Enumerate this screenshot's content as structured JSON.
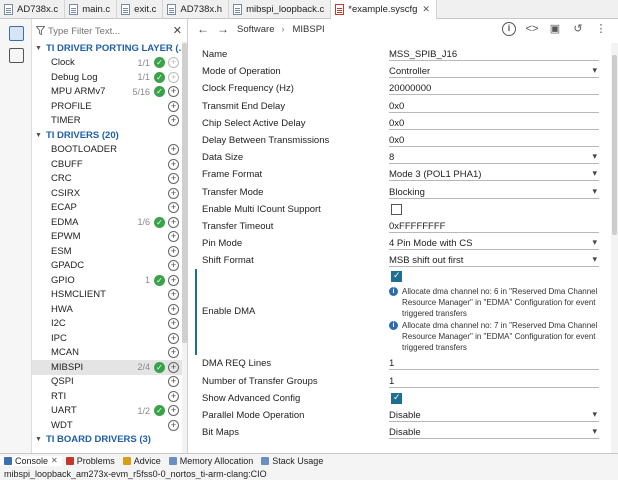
{
  "tabs": [
    {
      "label": "AD738x.c",
      "type": "c",
      "active": false,
      "dirty": false
    },
    {
      "label": "main.c",
      "type": "c",
      "active": false,
      "dirty": false
    },
    {
      "label": "exit.c",
      "type": "c",
      "active": false,
      "dirty": false
    },
    {
      "label": "AD738x.h",
      "type": "h",
      "active": false,
      "dirty": false
    },
    {
      "label": "mibspi_loopback.c",
      "type": "c",
      "active": false,
      "dirty": false
    },
    {
      "label": "*example.syscfg",
      "type": "cfg",
      "active": true,
      "dirty": true
    }
  ],
  "filter": {
    "placeholder": "Type Filter Text..."
  },
  "tree": [
    {
      "kind": "cat",
      "label": "TI DRIVER PORTING LAYER (..."
    },
    {
      "kind": "mod",
      "label": "Clock",
      "count": "1/1",
      "checked": true,
      "addable": false
    },
    {
      "kind": "mod",
      "label": "Debug Log",
      "count": "1/1",
      "checked": true,
      "addable": false
    },
    {
      "kind": "mod",
      "label": "MPU ARMv7",
      "count": "5/16",
      "checked": true,
      "addable": true
    },
    {
      "kind": "mod",
      "label": "PROFILE",
      "count": "",
      "checked": false,
      "addable": true
    },
    {
      "kind": "mod",
      "label": "TIMER",
      "count": "",
      "checked": false,
      "addable": true
    },
    {
      "kind": "cat",
      "label": "TI DRIVERS (20)"
    },
    {
      "kind": "mod",
      "label": "BOOTLOADER",
      "count": "",
      "checked": false,
      "addable": true
    },
    {
      "kind": "mod",
      "label": "CBUFF",
      "count": "",
      "checked": false,
      "addable": true
    },
    {
      "kind": "mod",
      "label": "CRC",
      "count": "",
      "checked": false,
      "addable": true
    },
    {
      "kind": "mod",
      "label": "CSIRX",
      "count": "",
      "checked": false,
      "addable": true
    },
    {
      "kind": "mod",
      "label": "ECAP",
      "count": "",
      "checked": false,
      "addable": true
    },
    {
      "kind": "mod",
      "label": "EDMA",
      "count": "1/6",
      "checked": true,
      "addable": true
    },
    {
      "kind": "mod",
      "label": "EPWM",
      "count": "",
      "checked": false,
      "addable": true
    },
    {
      "kind": "mod",
      "label": "ESM",
      "count": "",
      "checked": false,
      "addable": true
    },
    {
      "kind": "mod",
      "label": "GPADC",
      "count": "",
      "checked": false,
      "addable": true
    },
    {
      "kind": "mod",
      "label": "GPIO",
      "count": "1",
      "checked": true,
      "addable": true
    },
    {
      "kind": "mod",
      "label": "HSMCLIENT",
      "count": "",
      "checked": false,
      "addable": true
    },
    {
      "kind": "mod",
      "label": "HWA",
      "count": "",
      "checked": false,
      "addable": true
    },
    {
      "kind": "mod",
      "label": "I2C",
      "count": "",
      "checked": false,
      "addable": true
    },
    {
      "kind": "mod",
      "label": "IPC",
      "count": "",
      "checked": false,
      "addable": true
    },
    {
      "kind": "mod",
      "label": "MCAN",
      "count": "",
      "checked": false,
      "addable": true
    },
    {
      "kind": "mod",
      "label": "MIBSPI",
      "count": "2/4",
      "checked": true,
      "addable": true,
      "selected": true
    },
    {
      "kind": "mod",
      "label": "QSPI",
      "count": "",
      "checked": false,
      "addable": true
    },
    {
      "kind": "mod",
      "label": "RTI",
      "count": "",
      "checked": false,
      "addable": true
    },
    {
      "kind": "mod",
      "label": "UART",
      "count": "1/2",
      "checked": true,
      "addable": true
    },
    {
      "kind": "mod",
      "label": "WDT",
      "count": "",
      "checked": false,
      "addable": true
    },
    {
      "kind": "cat",
      "label": "TI BOARD DRIVERS (3)"
    }
  ],
  "breadcrumb": [
    "Software",
    "MIBSPI"
  ],
  "form": [
    {
      "label": "Name",
      "type": "text",
      "value": "MSS_SPIB_J16"
    },
    {
      "label": "Mode of Operation",
      "type": "select",
      "value": "Controller"
    },
    {
      "label": "Clock Frequency (Hz)",
      "type": "text",
      "value": "20000000"
    },
    {
      "label": "Transmit End Delay",
      "type": "text",
      "value": "0x0"
    },
    {
      "label": "Chip Select Active Delay",
      "type": "text",
      "value": "0x0"
    },
    {
      "label": "Delay Between Transmissions",
      "type": "text",
      "value": "0x0"
    },
    {
      "label": "Data Size",
      "type": "select",
      "value": "8"
    },
    {
      "label": "Frame Format",
      "type": "select",
      "value": "Mode 3 (POL1 PHA1)"
    },
    {
      "label": "Transfer Mode",
      "type": "select",
      "value": "Blocking"
    },
    {
      "label": "Enable Multi ICount Support",
      "type": "check",
      "value": false
    },
    {
      "label": "Transfer Timeout",
      "type": "text",
      "value": "0xFFFFFFFF"
    },
    {
      "label": "Pin Mode",
      "type": "select",
      "value": "4 Pin Mode with CS"
    },
    {
      "label": "Shift Format",
      "type": "select",
      "value": "MSB shift out first"
    },
    {
      "label": "Enable DMA",
      "type": "dma",
      "value": true,
      "messages": [
        "Allocate dma channel no: 6 in \"Reserved Dma Channel Resource Manager\" in \"EDMA\" Configuration for event triggered transfers",
        "Allocate dma channel no: 7 in \"Reserved Dma Channel Resource Manager\" in \"EDMA\" Configuration for event triggered transfers"
      ]
    },
    {
      "label": "DMA REQ Lines",
      "type": "text",
      "value": "1"
    },
    {
      "label": "Number of Transfer Groups",
      "type": "text",
      "value": "1"
    },
    {
      "label": "Show Advanced Config",
      "type": "check",
      "value": true
    },
    {
      "label": "Parallel Mode Operation",
      "type": "select",
      "value": "Disable"
    },
    {
      "label": "Bit Maps",
      "type": "select",
      "value": "Disable"
    }
  ],
  "bottom": {
    "tabs": [
      {
        "label": "Console",
        "color": "#3d6fb0",
        "closable": true,
        "active": true
      },
      {
        "label": "Problems",
        "color": "#c0392b",
        "closable": false,
        "active": false
      },
      {
        "label": "Advice",
        "color": "#d4a017",
        "closable": false,
        "active": false
      },
      {
        "label": "Memory Allocation",
        "color": "#6a8fc0",
        "closable": false,
        "active": false
      },
      {
        "label": "Stack Usage",
        "color": "#6a8fc0",
        "closable": false,
        "active": false
      }
    ],
    "console_text": "mibspi_loopback_am273x-evm_r5fss0-0_nortos_ti-arm-clang:CIO"
  }
}
